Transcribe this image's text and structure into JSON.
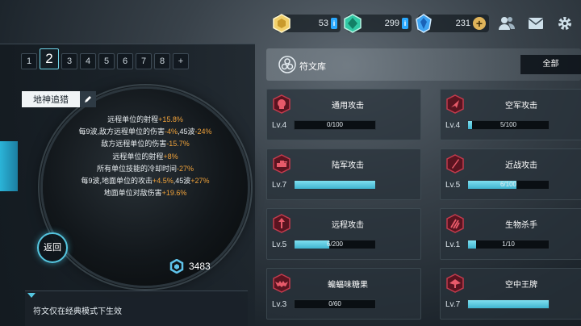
{
  "resources": [
    {
      "name": "gold",
      "icon": "yellow-hexagon-icon",
      "value": "53"
    },
    {
      "name": "green",
      "icon": "green-gem-icon",
      "value": "299"
    },
    {
      "name": "blue",
      "icon": "blue-crystal-icon",
      "value": "231"
    }
  ],
  "tabs": [
    "1",
    "2",
    "3",
    "4",
    "5",
    "6",
    "7",
    "8",
    "+"
  ],
  "active_tab": "2",
  "hero_name": "地神追猎",
  "bonuses": [
    {
      "text": "远程单位的射程",
      "value": "+15.8%"
    },
    {
      "text": "每9波,敌方远程单位的伤害",
      "value": "-4%",
      "text2": ",45波",
      "value2": "-24%"
    },
    {
      "text": "敌方远程单位的伤害",
      "value": "-15.7%"
    },
    {
      "text": "远程单位的射程",
      "value": "+8%"
    },
    {
      "text": "所有单位技能的冷却时间",
      "value": "-27%"
    },
    {
      "text": "每9波,地面单位的攻击",
      "value": "+4.5%",
      "text2": ",45波",
      "value2": "+27%"
    },
    {
      "text": "地面单位对敌伤害",
      "value": "+19.6%"
    }
  ],
  "back_label": "返回",
  "rune_count": "3483",
  "note": "符文仅在经典模式下生效",
  "library": {
    "title": "符文库",
    "filter": "全部"
  },
  "cards": [
    {
      "name": "通用攻击",
      "level": "Lv.4",
      "progress_text": "0/100",
      "fill": 0,
      "icon": "skull-badge-icon"
    },
    {
      "name": "空军攻击",
      "level": "Lv.4",
      "progress_text": "5/100",
      "fill": 0.05,
      "icon": "jet-badge-icon"
    },
    {
      "name": "陆军攻击",
      "level": "Lv.7",
      "progress_text": "",
      "fill": 1,
      "icon": "tank-badge-icon"
    },
    {
      "name": "近战攻击",
      "level": "Lv.5",
      "progress_text": "6/100",
      "fill": 0.6,
      "icon": "blade-badge-icon"
    },
    {
      "name": "远程攻击",
      "level": "Lv.5",
      "progress_text": "6/200",
      "fill": 0.43,
      "icon": "arrow-badge-icon"
    },
    {
      "name": "生物杀手",
      "level": "Lv.1",
      "progress_text": "1/10",
      "fill": 0.1,
      "icon": "claw-badge-icon"
    },
    {
      "name": "蝙蝠味糖果",
      "level": "Lv.3",
      "progress_text": "0/60",
      "fill": 0,
      "icon": "bat-badge-icon"
    },
    {
      "name": "空中王牌",
      "level": "Lv.7",
      "progress_text": "",
      "fill": 1,
      "icon": "ace-badge-icon"
    }
  ]
}
